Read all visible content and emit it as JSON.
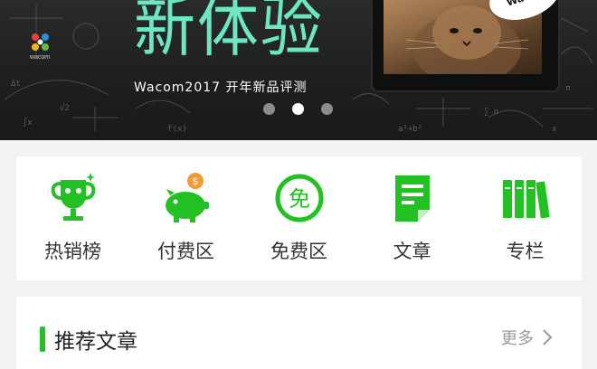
{
  "banner": {
    "headline": "新体验",
    "subline": "Wacom2017  开年新品评测",
    "logo_text": "wacom",
    "bubble_text": "Wa",
    "carousel": {
      "count": 3,
      "active_index": 1
    }
  },
  "categories": [
    {
      "label": "热销榜",
      "icon": "trophy-icon"
    },
    {
      "label": "付费区",
      "icon": "piggy-bank-icon"
    },
    {
      "label": "免费区",
      "icon": "free-badge-icon"
    },
    {
      "label": "文章",
      "icon": "article-icon"
    },
    {
      "label": "专栏",
      "icon": "bookshelf-icon"
    }
  ],
  "recommend": {
    "title": "推荐文章",
    "more_label": "更多"
  },
  "colors": {
    "accent": "#22c023",
    "headline": "#6fe6c3",
    "coin": "#f29a38"
  }
}
